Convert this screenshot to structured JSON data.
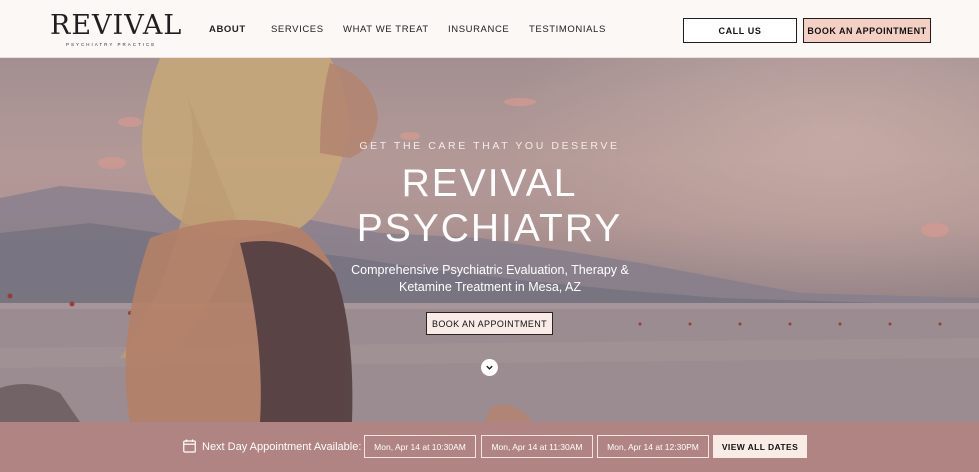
{
  "header": {
    "logo_text": "REVIVAL",
    "logo_subtext": "PSYCHIATRY PRACTICE",
    "nav": [
      {
        "label": "ABOUT",
        "active": true
      },
      {
        "label": "SERVICES",
        "active": false
      },
      {
        "label": "WHAT WE TREAT",
        "active": false
      },
      {
        "label": "INSURANCE",
        "active": false
      },
      {
        "label": "TESTIMONIALS",
        "active": false
      }
    ],
    "call_label": "CALL US",
    "book_label": "BOOK AN APPOINTMENT"
  },
  "hero": {
    "tagline": "GET THE CARE THAT YOU DESERVE",
    "title_line1": "REVIVAL",
    "title_line2": "PSYCHIATRY",
    "subtitle_line1": "Comprehensive Psychiatric Evaluation, Therapy &",
    "subtitle_line2": "Ketamine Treatment in Mesa, AZ",
    "cta_label": "BOOK AN APPOINTMENT",
    "scroll_icon": "chevron-down-icon"
  },
  "appointment_bar": {
    "icon": "calendar-icon",
    "label": "Next Day Appointment Available:",
    "slots": [
      "Mon, Apr 14 at 10:30AM",
      "Mon, Apr 14 at 11:30AM",
      "Mon, Apr 14 at 12:30PM"
    ],
    "view_all_label": "VIEW ALL DATES"
  },
  "colors": {
    "accent": "#f4d0c4",
    "bar": "#b08482",
    "header_bg": "#fbf8f6"
  }
}
